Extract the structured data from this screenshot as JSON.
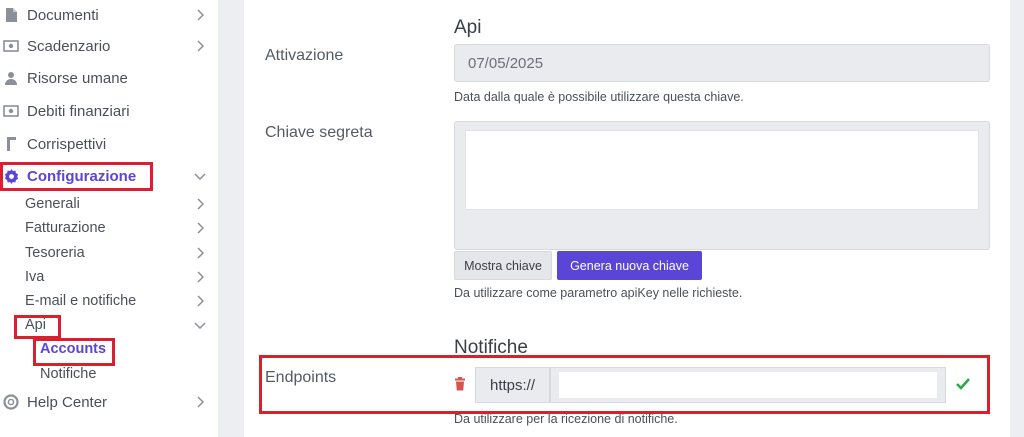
{
  "sidebar": {
    "items": [
      {
        "label": "Documenti",
        "icon": "document-icon"
      },
      {
        "label": "Scadenzario",
        "icon": "money-icon"
      },
      {
        "label": "Risorse umane",
        "icon": "person-icon"
      },
      {
        "label": "Debiti finanziari",
        "icon": "money-icon"
      },
      {
        "label": "Corrispettivi",
        "icon": "receipt-icon"
      },
      {
        "label": "Configurazione",
        "icon": "gear-icon"
      }
    ],
    "config_subitems": [
      {
        "label": "Generali"
      },
      {
        "label": "Fatturazione"
      },
      {
        "label": "Tesoreria"
      },
      {
        "label": "Iva"
      },
      {
        "label": "E-mail e notifiche"
      },
      {
        "label": "Api"
      }
    ],
    "api_subitems": [
      {
        "label": "Accounts"
      },
      {
        "label": "Notifiche"
      }
    ],
    "help": {
      "label": "Help Center",
      "icon": "lifebuoy-icon"
    }
  },
  "main": {
    "api_section_title": "Api",
    "activation": {
      "label": "Attivazione",
      "value": "07/05/2025",
      "help": "Data dalla quale è possibile utilizzare questa chiave."
    },
    "secret": {
      "label": "Chiave segreta",
      "show_button": "Mostra chiave",
      "generate_button": "Genera nuova chiave",
      "help": "Da utilizzare come parametro apiKey nelle richieste."
    },
    "notifications_title": "Notifiche",
    "endpoints": {
      "label": "Endpoints",
      "prefix": "https://",
      "value": "",
      "help": "Da utilizzare per la ricezione di notifiche."
    }
  },
  "colors": {
    "accent": "#5a45d6",
    "highlight": "#dc1f2e",
    "success": "#2ea84a",
    "danger": "#d9534f"
  }
}
